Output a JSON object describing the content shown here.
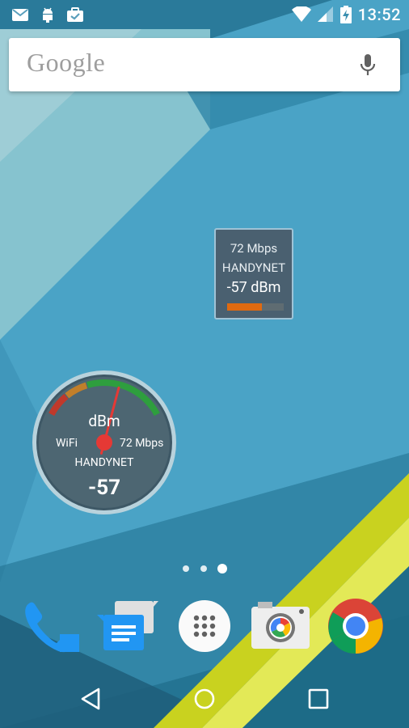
{
  "status_bar": {
    "time": "13:52",
    "left_icons": [
      "gmail-icon",
      "android-debug-icon",
      "briefcase-check-icon"
    ],
    "right_icons": [
      "wifi-icon",
      "cell-signal-icon",
      "battery-charging-icon"
    ]
  },
  "search": {
    "logo_text": "Google",
    "mic_icon": "mic-icon"
  },
  "wifi_info_widget": {
    "speed": "72 Mbps",
    "ssid": "HANDYNET",
    "signal": "-57 dBm",
    "signal_level": 0.62,
    "bar_color": "#e06a10"
  },
  "wifi_gauge_widget": {
    "unit": "dBm",
    "label": "WiFi",
    "speed": "72 Mbps",
    "ssid": "HANDYNET",
    "value": "-57",
    "needle_level": 0.62,
    "zone_colors": [
      "#c0392b",
      "#c17f2a",
      "#2e9e3e"
    ]
  },
  "home_pages": {
    "count": 3,
    "current": 3
  },
  "dock": [
    {
      "name": "phone",
      "icon": "phone-icon"
    },
    {
      "name": "messenger",
      "icon": "messenger-icon"
    },
    {
      "name": "app-drawer",
      "icon": "apps-grid-icon"
    },
    {
      "name": "camera",
      "icon": "camera-icon"
    },
    {
      "name": "chrome",
      "icon": "chrome-icon"
    }
  ],
  "nav": [
    "back-icon",
    "home-icon",
    "recents-icon"
  ],
  "colors": {
    "accent_teal": "#3fa3c4",
    "dock_blue": "#2196f3",
    "wallpaper_yellow": "#d4dc2a"
  }
}
